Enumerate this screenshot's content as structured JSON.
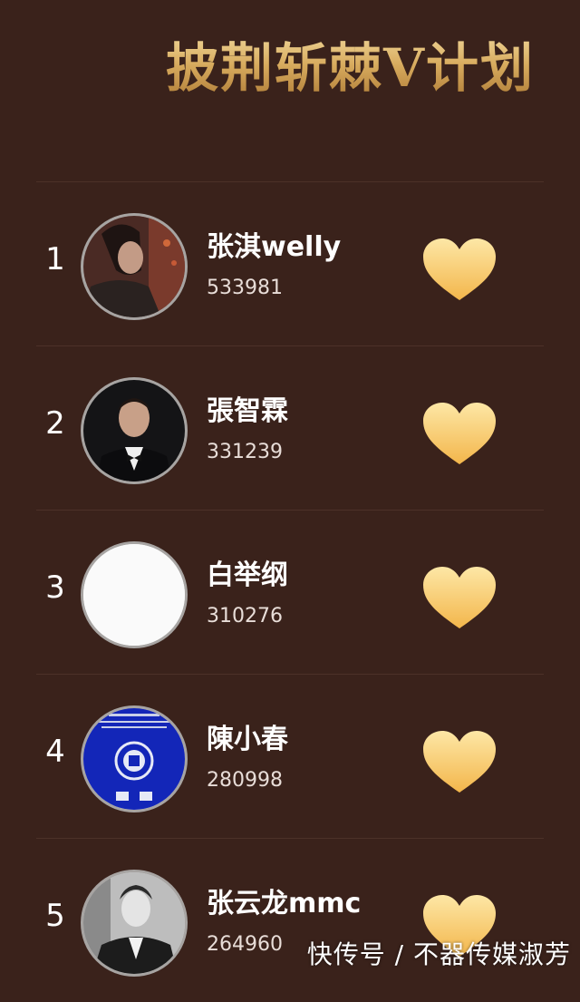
{
  "page_title": "披荆斩棘V计划",
  "rankings": [
    {
      "rank": "1",
      "name": "张淇welly",
      "votes": "533981",
      "avatar": "portrait-photo-1"
    },
    {
      "rank": "2",
      "name": "張智霖",
      "votes": "331239",
      "avatar": "portrait-photo-2"
    },
    {
      "rank": "3",
      "name": "白举纲",
      "votes": "310276",
      "avatar": "blank-avatar"
    },
    {
      "rank": "4",
      "name": "陳小春",
      "votes": "280998",
      "avatar": "hong-kong-passport-cover"
    },
    {
      "rank": "5",
      "name": "张云龙mmc",
      "votes": "264960",
      "avatar": "portrait-photo-bw"
    }
  ],
  "vote_button_icon": "heart-icon",
  "watermark": "快传号 / 不器传媒淑芳",
  "colors": {
    "background": "#3a221b",
    "title_gold": "#d7aa5d",
    "heart_top": "#fde7a6",
    "heart_bottom": "#f3b64b"
  }
}
